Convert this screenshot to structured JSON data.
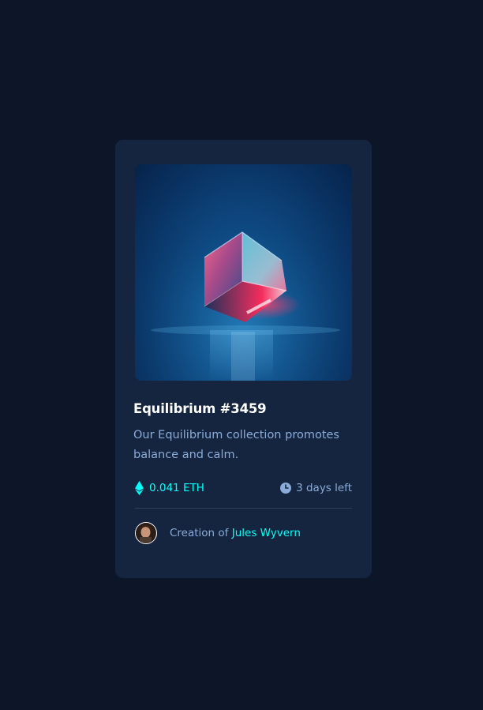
{
  "card": {
    "image_alt": "Equilibrium cube image",
    "title": "Equilibrium #3459",
    "description": "Our Equilibrium collection promotes balance and calm.",
    "price": "0.041 ETH",
    "time_left": "3 days left",
    "creator_prefix": "Creation of",
    "creator_name": "Jules Wyvern"
  },
  "icons": {
    "price": "ethereum-icon",
    "time": "clock-icon"
  },
  "colors": {
    "page_background": "#0d1629",
    "card_background": "#15253f",
    "accent_cyan": "#00fff8",
    "soft_blue": "#8bacd9",
    "white": "#ffffff",
    "divider": "#2e405a"
  }
}
